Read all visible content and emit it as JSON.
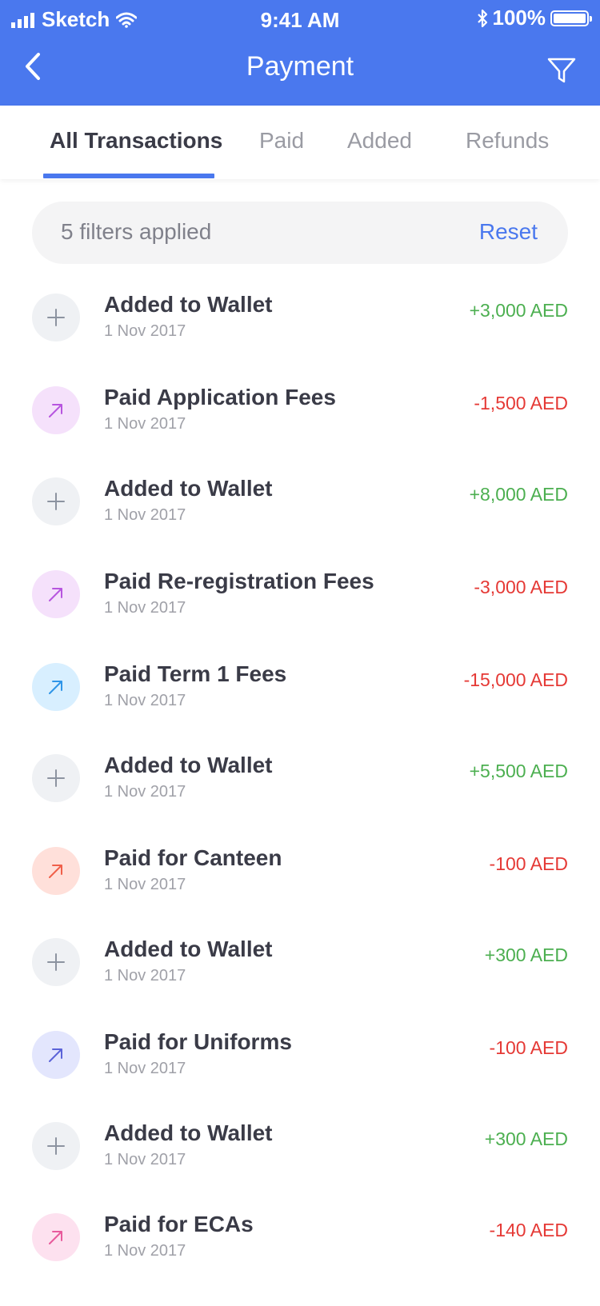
{
  "status_bar": {
    "carrier": "Sketch",
    "time": "9:41 AM",
    "battery": "100%"
  },
  "header": {
    "title": "Payment"
  },
  "tabs": [
    {
      "label": "All Transactions",
      "active": true
    },
    {
      "label": "Paid"
    },
    {
      "label": "Added"
    },
    {
      "label": "Refunds"
    }
  ],
  "filter_bar": {
    "text": "5 filters applied",
    "reset": "Reset"
  },
  "colors": {
    "accent": "#4a78ee",
    "positive": "#4caf50",
    "negative": "#e53935"
  },
  "transactions": [
    {
      "title": "Added to Wallet",
      "date": "1 Nov 2017",
      "amount": "+3,000 AED",
      "type": "added",
      "icon": "plus-icon",
      "icon_bg": "#eff1f4",
      "icon_color": "#8c93a0"
    },
    {
      "title": "Paid Application Fees",
      "date": "1 Nov 2017",
      "amount": "-1,500 AED",
      "type": "paid",
      "icon": "arrow-up-right-icon",
      "icon_bg": "#f5e1fb",
      "icon_color": "#b755df"
    },
    {
      "title": "Added to Wallet",
      "date": "1 Nov 2017",
      "amount": "+8,000 AED",
      "type": "added",
      "icon": "plus-icon",
      "icon_bg": "#eff1f4",
      "icon_color": "#8c93a0"
    },
    {
      "title": "Paid Re-registration Fees",
      "date": "1 Nov 2017",
      "amount": "-3,000 AED",
      "type": "paid",
      "icon": "arrow-up-right-icon",
      "icon_bg": "#f5e1fb",
      "icon_color": "#b755df"
    },
    {
      "title": "Paid Term 1 Fees",
      "date": "1 Nov 2017",
      "amount": "-15,000 AED",
      "type": "paid",
      "icon": "arrow-up-right-icon",
      "icon_bg": "#d8efff",
      "icon_color": "#2f95e8"
    },
    {
      "title": "Added to Wallet",
      "date": "1 Nov 2017",
      "amount": "+5,500 AED",
      "type": "added",
      "icon": "plus-icon",
      "icon_bg": "#eff1f4",
      "icon_color": "#8c93a0"
    },
    {
      "title": "Paid for Canteen",
      "date": "1 Nov 2017",
      "amount": "-100 AED",
      "type": "paid",
      "icon": "arrow-up-right-icon",
      "icon_bg": "#ffe0da",
      "icon_color": "#f0604a"
    },
    {
      "title": "Added to Wallet",
      "date": "1 Nov 2017",
      "amount": "+300 AED",
      "type": "added",
      "icon": "plus-icon",
      "icon_bg": "#eff1f4",
      "icon_color": "#8c93a0"
    },
    {
      "title": "Paid for Uniforms",
      "date": "1 Nov 2017",
      "amount": "-100 AED",
      "type": "paid",
      "icon": "arrow-up-right-icon",
      "icon_bg": "#e3e6fd",
      "icon_color": "#5b63d8"
    },
    {
      "title": "Added to Wallet",
      "date": "1 Nov 2017",
      "amount": "+300 AED",
      "type": "added",
      "icon": "plus-icon",
      "icon_bg": "#eff1f4",
      "icon_color": "#8c93a0"
    },
    {
      "title": "Paid for ECAs",
      "date": "1 Nov 2017",
      "amount": "-140 AED",
      "type": "paid",
      "icon": "arrow-up-right-icon",
      "icon_bg": "#fde1ef",
      "icon_color": "#e85a9c"
    }
  ]
}
